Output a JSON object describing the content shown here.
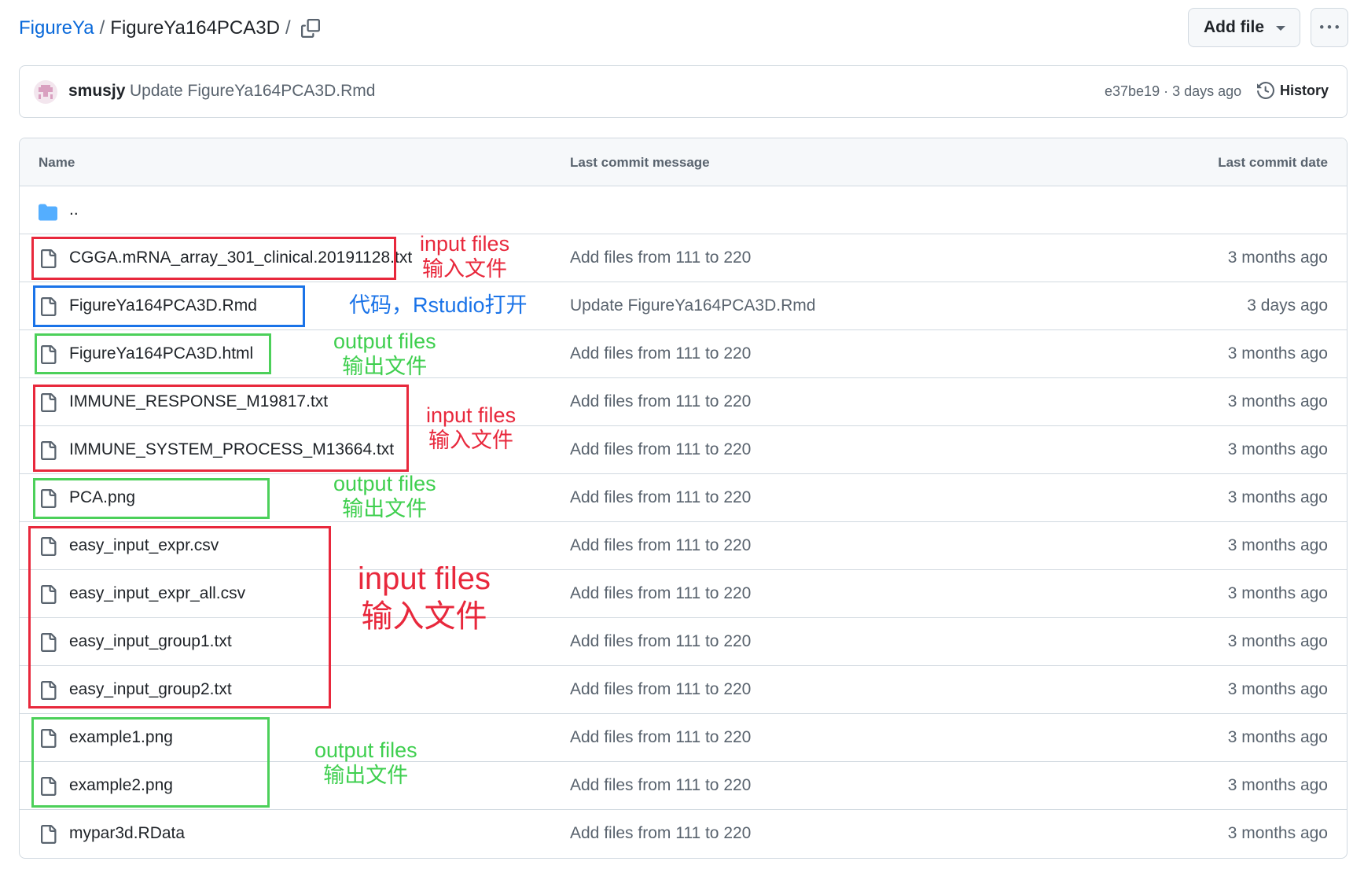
{
  "breadcrumb": {
    "owner": "FigureYa",
    "separator": "/",
    "repo": "FigureYa164PCA3D"
  },
  "actions": {
    "add_file_label": "Add file"
  },
  "latest_commit": {
    "user": "smusjy",
    "message": "Update FigureYa164PCA3D.Rmd",
    "meta": "e37be19 · 3 days ago",
    "history_label": "History"
  },
  "table": {
    "headers": {
      "name": "Name",
      "message": "Last commit message",
      "date": "Last commit date"
    },
    "parent_dir": "..",
    "files": [
      {
        "name": "CGGA.mRNA_array_301_clinical.20191128.txt",
        "message": "Add files from 111 to 220",
        "date": "3 months ago"
      },
      {
        "name": "FigureYa164PCA3D.Rmd",
        "message": "Update FigureYa164PCA3D.Rmd",
        "date": "3 days ago"
      },
      {
        "name": "FigureYa164PCA3D.html",
        "message": "Add files from 111 to 220",
        "date": "3 months ago"
      },
      {
        "name": "IMMUNE_RESPONSE_M19817.txt",
        "message": "Add files from 111 to 220",
        "date": "3 months ago"
      },
      {
        "name": "IMMUNE_SYSTEM_PROCESS_M13664.txt",
        "message": "Add files from 111 to 220",
        "date": "3 months ago"
      },
      {
        "name": "PCA.png",
        "message": "Add files from 111 to 220",
        "date": "3 months ago"
      },
      {
        "name": "easy_input_expr.csv",
        "message": "Add files from 111 to 220",
        "date": "3 months ago"
      },
      {
        "name": "easy_input_expr_all.csv",
        "message": "Add files from 111 to 220",
        "date": "3 months ago"
      },
      {
        "name": "easy_input_group1.txt",
        "message": "Add files from 111 to 220",
        "date": "3 months ago"
      },
      {
        "name": "easy_input_group2.txt",
        "message": "Add files from 111 to 220",
        "date": "3 months ago"
      },
      {
        "name": "example1.png",
        "message": "Add files from 111 to 220",
        "date": "3 months ago"
      },
      {
        "name": "example2.png",
        "message": "Add files from 111 to 220",
        "date": "3 months ago"
      },
      {
        "name": "mypar3d.RData",
        "message": "Add files from 111 to 220",
        "date": "3 months ago"
      }
    ]
  },
  "annotations": {
    "input_en": "input files",
    "input_zh": "输入文件",
    "output_en": "output files",
    "output_zh": "输出文件",
    "code_note": "代码，Rstudio打开"
  },
  "colors": {
    "link": "#0969da",
    "input_box": "#e8283c",
    "output_box": "#4cd05a",
    "code_box": "#1a73e8"
  }
}
